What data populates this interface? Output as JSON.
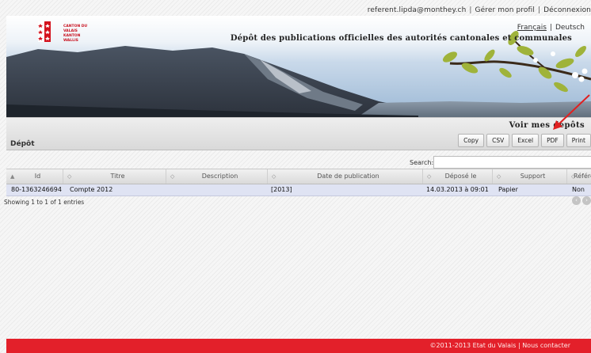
{
  "top": {
    "user": "referent.lipda@monthey.ch",
    "profile_link": "Gérer mon profil",
    "logout_link": "Déconnexion"
  },
  "header": {
    "logo_line1": "CANTON DU VALAIS",
    "logo_line2": "KANTON WALLIS",
    "lang_fr": "Français",
    "lang_de": "Deutsch",
    "title": "Dépôt des publications officielles des autorités cantonales et communales"
  },
  "nav": {
    "voir_mes_depots": "Voir mes dépôts",
    "section_title": "Dépôt"
  },
  "toolbar": {
    "copy": "Copy",
    "csv": "CSV",
    "excel": "Excel",
    "pdf": "PDF",
    "print": "Print"
  },
  "search": {
    "label": "Search:",
    "value": ""
  },
  "table": {
    "columns": [
      "Id",
      "Titre",
      "Description",
      "Date de publication",
      "Déposé le",
      "Support",
      "Référence"
    ],
    "rows": [
      {
        "id": "80-1363246694",
        "titre": "Compte 2012",
        "description": "",
        "date_publication": "[2013]",
        "depose_le": "14.03.2013 à 09:01",
        "support": "Papier",
        "reference": "Non"
      }
    ],
    "info": "Showing 1 to 1 of 1 entries"
  },
  "footer": {
    "copyright": "©2011-2013 Etat du Valais",
    "contact": "Nous contacter"
  },
  "colors": {
    "footer_red": "#e3202a",
    "row_highlight": "#dfe3f3",
    "annotation_arrow": "#e02020"
  }
}
